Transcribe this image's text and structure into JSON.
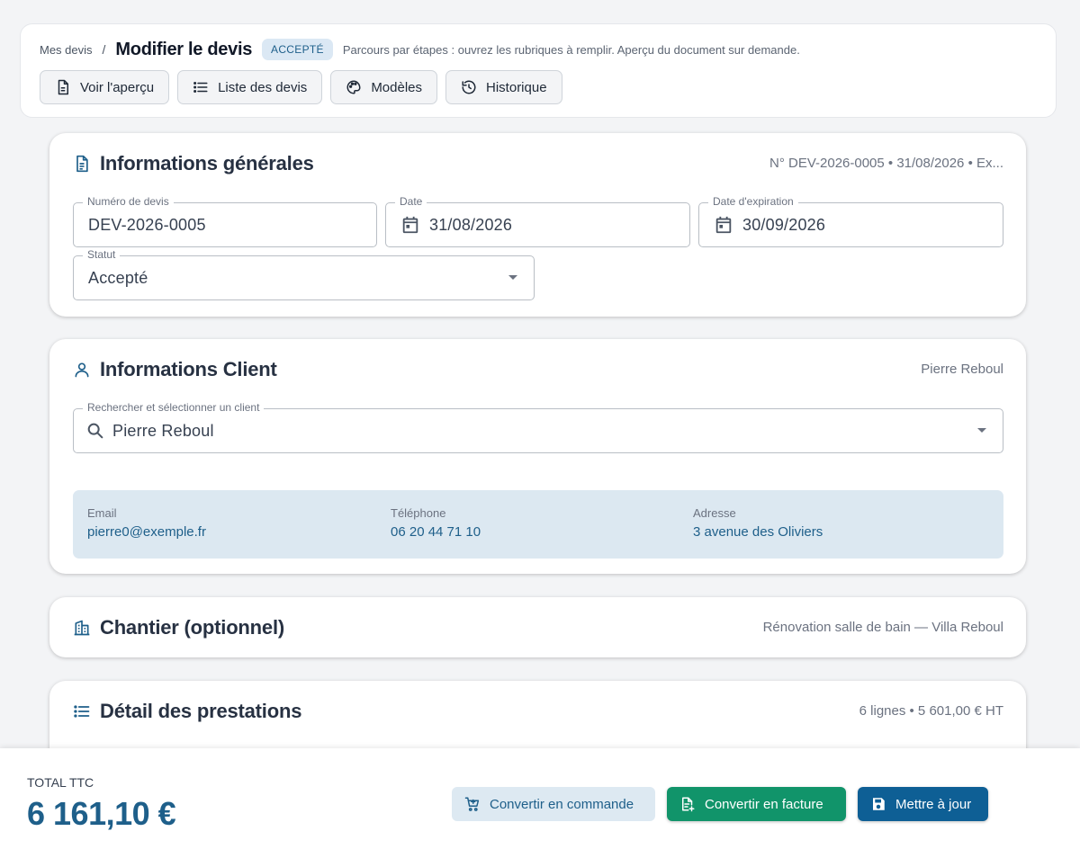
{
  "header": {
    "breadcrumb_parent": "Mes devis",
    "breadcrumb_sep": "/",
    "title": "Modifier le devis",
    "status_chip": "ACCEPTÉ",
    "hint": "Parcours par étapes : ouvrez les rubriques à remplir. Aperçu du document sur demande.",
    "buttons": {
      "preview": "Voir l'aperçu",
      "list": "Liste des devis",
      "templates": "Modèles",
      "history": "Historique"
    }
  },
  "general": {
    "title": "Informations générales",
    "meta": "N° DEV-2026-0005 • 31/08/2026 • Ex...",
    "quote_number_label": "Numéro de devis",
    "quote_number": "DEV-2026-0005",
    "date_label": "Date",
    "date": "31/08/2026",
    "expiry_label": "Date d'expiration",
    "expiry": "30/09/2026",
    "status_label": "Statut",
    "status": "Accepté"
  },
  "client": {
    "title": "Informations Client",
    "meta": "Pierre Reboul",
    "search_label": "Rechercher et sélectionner un client",
    "search_value": "Pierre Reboul",
    "email_label": "Email",
    "email": "pierre0@exemple.fr",
    "phone_label": "Téléphone",
    "phone": "06 20 44 71 10",
    "address_label": "Adresse",
    "address": "3 avenue des Oliviers"
  },
  "site": {
    "title": "Chantier (optionnel)",
    "meta": "Rénovation salle de bain — Villa Reboul"
  },
  "services": {
    "title": "Détail des prestations",
    "meta": "6 lignes • 5 601,00 € HT"
  },
  "footer": {
    "total_label": "TOTAL TTC",
    "total_value": "6 161,10 €",
    "convert_order": "Convertir en commande",
    "convert_invoice": "Convertir en facture",
    "update": "Mettre à jour"
  },
  "colors": {
    "accent": "#1e5f8a",
    "success": "#11946a",
    "primary": "#0e5f95"
  }
}
